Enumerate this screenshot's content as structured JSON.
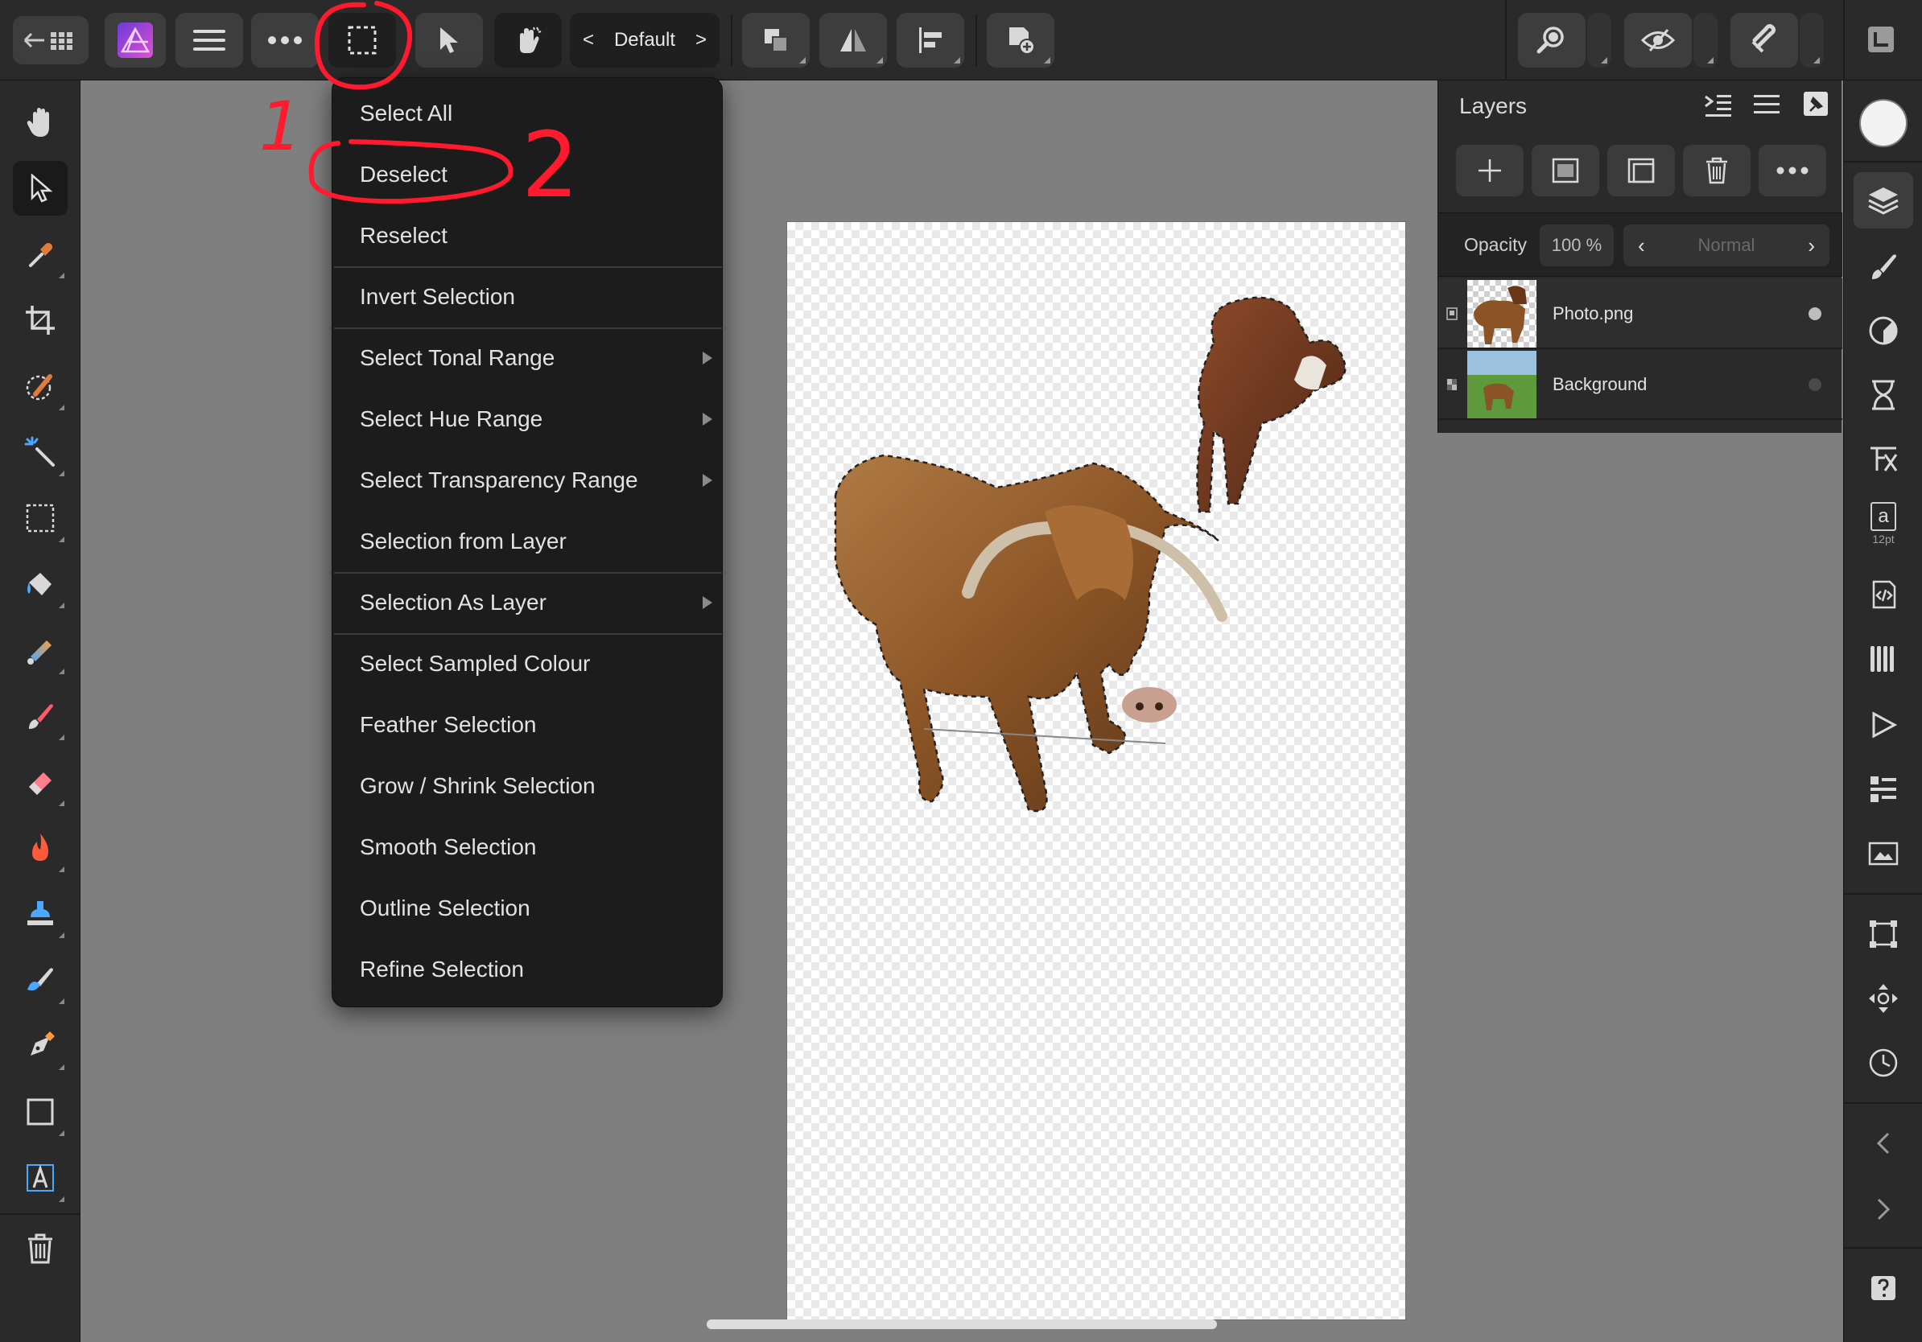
{
  "toolbar": {
    "persona_label": "Default",
    "persona_prev": "<",
    "persona_next": ">"
  },
  "selection_menu": {
    "items": [
      {
        "label": "Select All",
        "submenu": false
      },
      {
        "label": "Deselect",
        "submenu": false
      },
      {
        "label": "Reselect",
        "submenu": false
      },
      {
        "label": "Invert Selection",
        "submenu": false
      },
      {
        "label": "Select Tonal Range",
        "submenu": true
      },
      {
        "label": "Select Hue Range",
        "submenu": true
      },
      {
        "label": "Select Transparency Range",
        "submenu": true
      },
      {
        "label": "Selection from Layer",
        "submenu": false
      },
      {
        "label": "Selection As Layer",
        "submenu": true
      },
      {
        "label": "Select Sampled Colour",
        "submenu": false
      },
      {
        "label": "Feather Selection",
        "submenu": false
      },
      {
        "label": "Grow / Shrink Selection",
        "submenu": false
      },
      {
        "label": "Smooth Selection",
        "submenu": false
      },
      {
        "label": "Outline Selection",
        "submenu": false
      },
      {
        "label": "Refine Selection",
        "submenu": false
      }
    ]
  },
  "layers_panel": {
    "title": "Layers",
    "opacity_label": "Opacity",
    "opacity_value": "100 %",
    "blend_mode": "Normal",
    "layers": [
      {
        "name": "Photo.png",
        "visible_dot_color": "#bdbdbd"
      },
      {
        "name": "Background",
        "visible_dot_color": "#4a4a4a"
      }
    ]
  },
  "studio": {
    "text_style_letter": "a",
    "text_style_size": "12pt"
  },
  "annotations": {
    "step1": "1",
    "step2": "2",
    "color": "#ff1a2e"
  },
  "colors": {
    "ui_dark": "#2a2a2a",
    "menu_bg": "#1c1c1c",
    "canvas_bg": "#7f7f7f",
    "brand_purple": "#b14ad6"
  }
}
